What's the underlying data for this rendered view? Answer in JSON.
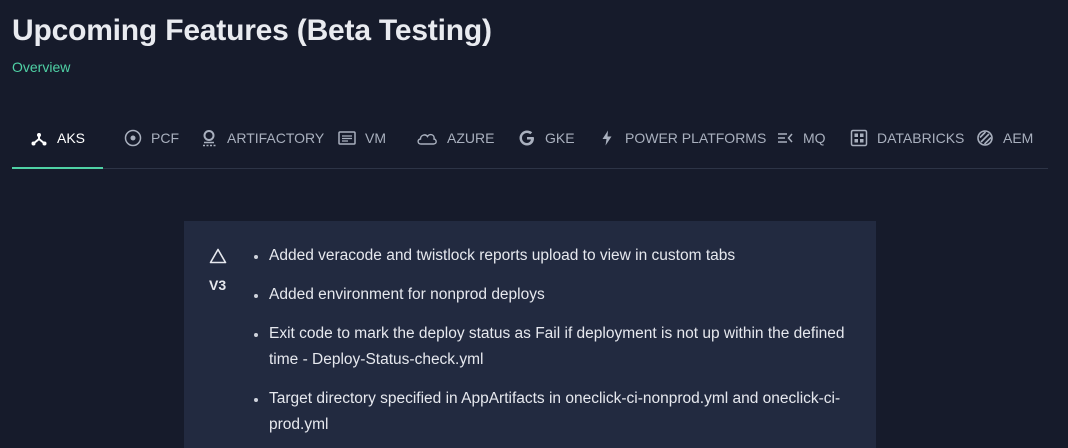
{
  "header": {
    "title": "Upcoming Features (Beta Testing)",
    "subtitle": "Overview"
  },
  "tabs": [
    {
      "label": "AKS",
      "icon": "network-icon",
      "active": true
    },
    {
      "label": "PCF",
      "icon": "target-icon",
      "active": false
    },
    {
      "label": "ARTIFACTORY",
      "icon": "artifactory-icon",
      "active": false
    },
    {
      "label": "VM",
      "icon": "vm-icon",
      "active": false
    },
    {
      "label": "AZURE",
      "icon": "cloud-icon",
      "active": false
    },
    {
      "label": "GKE",
      "icon": "google-icon",
      "active": false
    },
    {
      "label": "POWER PLATFORMS",
      "icon": "lightning-icon",
      "active": false
    },
    {
      "label": "MQ",
      "icon": "queue-icon",
      "active": false
    },
    {
      "label": "DATABRICKS",
      "icon": "grid-icon",
      "active": false
    },
    {
      "label": "AEM",
      "icon": "aem-icon",
      "active": false
    }
  ],
  "release": {
    "version": "V3",
    "icon": "triangle-icon",
    "changes": [
      "Added veracode and twistlock reports upload to view in custom tabs",
      "Added environment for nonprod deploys",
      "Exit code to mark the deploy status as Fail if deployment is not up within the defined time - Deploy-Status-check.yml",
      "Target directory specified in AppArtifacts in oneclick-ci-nonprod.yml and oneclick-ci-prod.yml"
    ]
  },
  "colors": {
    "background": "#161b2b",
    "card": "#222a40",
    "accent": "#4fd1a5"
  }
}
